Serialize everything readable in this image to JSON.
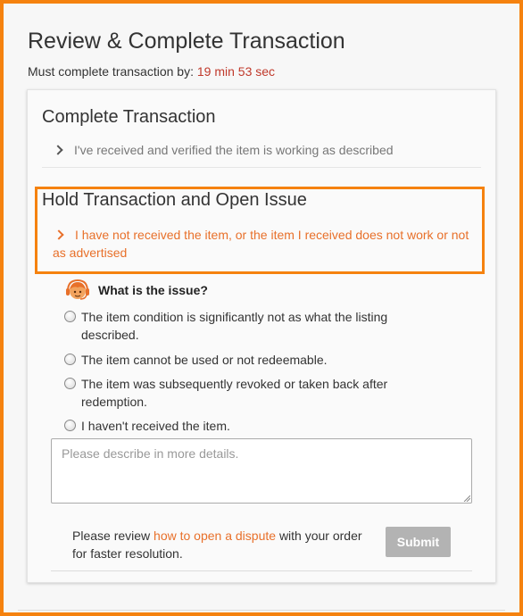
{
  "page": {
    "title": "Review & Complete Transaction",
    "deadline_label": "Must complete transaction by:",
    "deadline_time": "19 min 53 sec"
  },
  "complete_section": {
    "title": "Complete Transaction",
    "option": "I've received and verified the item is working as described"
  },
  "hold_section": {
    "title": "Hold Transaction and Open Issue",
    "option": "I have not received the item, or the item I received does not work or not as advertised"
  },
  "issue": {
    "question": "What is the issue?",
    "options": [
      "The item condition is significantly not as what the listing described.",
      "The item cannot be used or not redeemable.",
      "The item was subsequently revoked or taken back after redemption.",
      "I haven't received the item."
    ],
    "details_placeholder": "Please describe in more details."
  },
  "footer": {
    "review_prefix": "Please review",
    "review_link": "how to open a dispute",
    "review_suffix": "with your order for faster resolution.",
    "submit_label": "Submit"
  },
  "colors": {
    "accent": "#f5820f",
    "link": "#e8702a",
    "timer": "#c0392b",
    "submit_disabled": "#b3b3b3"
  },
  "icons": {
    "option_chevron": "chevron-right-icon",
    "issue_agent": "support-agent-icon"
  }
}
